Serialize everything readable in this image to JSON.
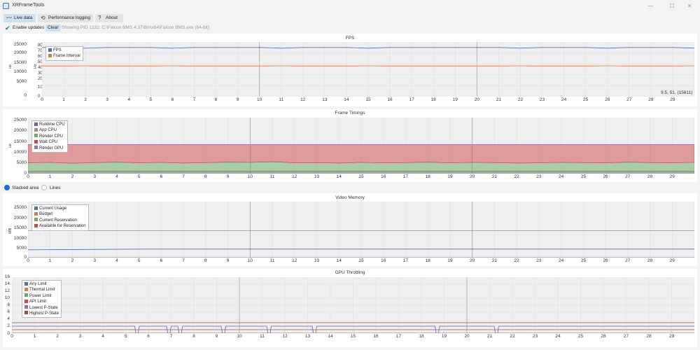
{
  "window": {
    "title": "XRFrameTools",
    "minimize_glyph": "—",
    "maximize_glyph": "☐",
    "close_glyph": "✕"
  },
  "tabs": [
    {
      "label": "Live data",
      "icon": "pulse-icon",
      "glyph": "〰",
      "active": true
    },
    {
      "label": "Performance logging",
      "icon": "history-icon",
      "glyph": "⟲",
      "active": false
    },
    {
      "label": "About",
      "icon": "help-icon",
      "glyph": "?",
      "active": false
    }
  ],
  "toolbar": {
    "enable_updates_label": "Enable updates",
    "enable_updates_checked": true,
    "check_glyph": "✔",
    "clear_label": "Clear",
    "status_text": "Showing PID 1232: C:\\Falcon BMS 4.37\\Bin\\x64\\Falcon BMS.exe (64-bit)"
  },
  "x_axis_ticks": [
    "0",
    "1",
    "2",
    "3",
    "4",
    "5",
    "6",
    "7",
    "8",
    "9",
    "10",
    "11",
    "12",
    "13",
    "14",
    "15",
    "16",
    "17",
    "18",
    "19",
    "20",
    "21",
    "22",
    "23",
    "24",
    "25",
    "26",
    "27",
    "28",
    "29"
  ],
  "fps_chart": {
    "title": "FPS",
    "y_unit": "us",
    "y_unit_right": "Hz",
    "y_ticks_left": [
      "25000",
      "20000",
      "15000",
      "10000",
      "5000",
      "0"
    ],
    "y_ticks_right": [
      "80",
      "70",
      "60",
      "50",
      "40",
      "30",
      "20",
      "10",
      "0"
    ],
    "readout": "9.5, 51, (15811)",
    "legend": [
      {
        "name": "FPS",
        "color": "#4f6fb5"
      },
      {
        "name": "Frame Interval",
        "color": "#e07a45"
      }
    ]
  },
  "frame_timings_chart": {
    "title": "Frame Timings",
    "y_unit": "us",
    "y_ticks": [
      "25000",
      "20000",
      "15000",
      "10000",
      "5000",
      "0"
    ],
    "legend": [
      {
        "name": "Runtime CPU",
        "color": "#4f6fb5"
      },
      {
        "name": "App CPU",
        "color": "#e07a45"
      },
      {
        "name": "Render CPU",
        "color": "#5fae5f"
      },
      {
        "name": "Wait CPU",
        "color": "#d04545"
      },
      {
        "name": "Render GPU",
        "color": "#8e72c0"
      }
    ]
  },
  "display_mode": {
    "stacked_label": "Stacked area",
    "lines_label": "Lines",
    "selected": "stacked"
  },
  "video_memory_chart": {
    "title": "Video Memory",
    "y_unit": "MB",
    "y_ticks": [
      "25000",
      "20000",
      "15000",
      "10000",
      "5000",
      "0"
    ],
    "legend": [
      {
        "name": "Current Usage",
        "color": "#4f6fb5"
      },
      {
        "name": "Budget",
        "color": "#e07a45"
      },
      {
        "name": "Current Reservation",
        "color": "#5fae5f"
      },
      {
        "name": "Available for Reservation",
        "color": "#d04545"
      }
    ]
  },
  "gpu_throttling_chart": {
    "title": "GPU Throttling",
    "y_ticks": [
      "16",
      "14",
      "12",
      "10",
      "8",
      "6",
      "4",
      "2",
      "0"
    ],
    "legend": [
      {
        "name": "Any Limit",
        "color": "#4f6fb5"
      },
      {
        "name": "Thermal Limit",
        "color": "#e07a45"
      },
      {
        "name": "Power Limit",
        "color": "#5fae5f"
      },
      {
        "name": "API Limit",
        "color": "#d04545"
      },
      {
        "name": "Lowest P-State",
        "color": "#8e72c0"
      },
      {
        "name": "Highest P-State",
        "color": "#8b5a3c"
      }
    ]
  },
  "chart_data": [
    {
      "type": "line",
      "title": "FPS",
      "x_range": [
        0,
        30
      ],
      "ylim_left": [
        0,
        25000
      ],
      "ylim_right": [
        0,
        80
      ],
      "xlabel": "",
      "ylabel": "us",
      "grid": true,
      "legend_position": "top-left",
      "series": [
        {
          "name": "FPS",
          "axis": "right",
          "color": "#4f6fb5",
          "x": [
            0,
            1,
            2,
            3,
            4,
            5,
            6,
            7,
            8,
            9,
            10,
            11,
            12,
            13,
            14,
            15,
            16,
            17,
            18,
            19,
            20,
            21,
            22,
            23,
            24,
            25,
            26,
            27,
            28,
            29,
            30
          ],
          "values": [
            72,
            72,
            71,
            72,
            72,
            72,
            71,
            72,
            72,
            72,
            72,
            71,
            72,
            72,
            72,
            71,
            72,
            72,
            72,
            72,
            72,
            72,
            71,
            72,
            72,
            72,
            71,
            72,
            72,
            72,
            71
          ]
        },
        {
          "name": "Frame Interval",
          "axis": "left",
          "color": "#e07a45",
          "x": [
            0,
            1,
            2,
            3,
            4,
            5,
            6,
            7,
            8,
            9,
            10,
            11,
            12,
            13,
            14,
            15,
            16,
            17,
            18,
            19,
            20,
            21,
            22,
            23,
            24,
            25,
            26,
            27,
            28,
            29,
            30
          ],
          "values": [
            14000,
            14000,
            14100,
            14000,
            14000,
            14000,
            14100,
            14000,
            14000,
            14000,
            14000,
            14100,
            14000,
            14000,
            14000,
            14100,
            14000,
            14000,
            14000,
            14000,
            14000,
            14000,
            14100,
            14000,
            14000,
            14000,
            14100,
            14000,
            14000,
            14000,
            14100
          ]
        }
      ]
    },
    {
      "type": "area",
      "title": "Frame Timings",
      "stacked": true,
      "x_range": [
        0,
        30
      ],
      "ylim": [
        0,
        27000
      ],
      "xlabel": "",
      "ylabel": "us",
      "grid": true,
      "legend_position": "top-left",
      "x": [
        0,
        1,
        2,
        3,
        4,
        5,
        6,
        7,
        8,
        9,
        10,
        11,
        12,
        13,
        14,
        15,
        16,
        17,
        18,
        19,
        20,
        21,
        22,
        23,
        24,
        25,
        26,
        27,
        28,
        29,
        30
      ],
      "series": [
        {
          "name": "Runtime CPU",
          "color": "#4f6fb5",
          "values": [
            1000,
            1000,
            1000,
            1000,
            1000,
            1000,
            1000,
            1000,
            1000,
            1000,
            1000,
            1000,
            1000,
            1000,
            1000,
            1000,
            1000,
            1000,
            1000,
            1000,
            1000,
            1000,
            1000,
            1000,
            1000,
            1000,
            1000,
            1000,
            1000,
            1000,
            1000
          ]
        },
        {
          "name": "App CPU",
          "color": "#e07a45",
          "values": [
            200,
            200,
            200,
            200,
            200,
            200,
            200,
            200,
            200,
            200,
            200,
            200,
            200,
            200,
            200,
            200,
            200,
            200,
            200,
            200,
            200,
            200,
            200,
            200,
            200,
            200,
            200,
            200,
            200,
            200,
            200
          ]
        },
        {
          "name": "Render CPU",
          "color": "#5fae5f",
          "values": [
            4000,
            4200,
            3800,
            4100,
            4300,
            4000,
            4200,
            3900,
            4100,
            4300,
            4200,
            4500,
            4000,
            4100,
            3900,
            4200,
            4000,
            4100,
            4300,
            4000,
            4200,
            4100,
            3900,
            4000,
            4200,
            4100,
            4000,
            4300,
            4100,
            4000,
            4200
          ]
        },
        {
          "name": "Wait CPU",
          "color": "#d04545",
          "values": [
            8800,
            8600,
            9000,
            8700,
            8500,
            8800,
            8600,
            8900,
            8700,
            8500,
            8600,
            8300,
            8800,
            8700,
            8900,
            8600,
            8800,
            8700,
            8500,
            8800,
            8600,
            8700,
            8900,
            8800,
            8600,
            8700,
            8800,
            8500,
            8700,
            8800,
            8600
          ]
        },
        {
          "name": "Render GPU",
          "color": "#8e72c0",
          "values": [
            0,
            0,
            0,
            0,
            0,
            0,
            0,
            0,
            0,
            0,
            0,
            0,
            0,
            0,
            0,
            0,
            0,
            0,
            0,
            0,
            0,
            0,
            0,
            0,
            0,
            0,
            0,
            0,
            0,
            0,
            0
          ]
        }
      ]
    },
    {
      "type": "line",
      "title": "Video Memory",
      "x_range": [
        0,
        30
      ],
      "ylim": [
        0,
        25000
      ],
      "xlabel": "",
      "ylabel": "MB",
      "grid": true,
      "legend_position": "top-left",
      "x": [
        0,
        5.5,
        30
      ],
      "series": [
        {
          "name": "Current Usage",
          "color": "#4f6fb5",
          "values": [
            3500,
            3800,
            3800
          ]
        },
        {
          "name": "Budget",
          "color": "#e07a45",
          "values": [
            12000,
            12000,
            12000
          ]
        },
        {
          "name": "Current Reservation",
          "color": "#5fae5f",
          "values": [
            0,
            0,
            0
          ]
        },
        {
          "name": "Available for Reservation",
          "color": "#d04545",
          "values": [
            0,
            0,
            0
          ]
        }
      ]
    },
    {
      "type": "line",
      "title": "GPU Throttling",
      "x_range": [
        0,
        30
      ],
      "ylim": [
        0,
        16
      ],
      "xlabel": "",
      "ylabel": "",
      "grid": true,
      "legend_position": "top-left",
      "series": [
        {
          "name": "Any Limit",
          "color": "#4f6fb5",
          "x": [
            0,
            5.4,
            5.45,
            5.55,
            5.6,
            6.8,
            6.85,
            6.95,
            7.0,
            7.3,
            7.35,
            7.45,
            7.5,
            9.2,
            9.25,
            9.35,
            9.4,
            11.2,
            11.25,
            11.35,
            11.4,
            13.2,
            13.25,
            13.35,
            13.4,
            18.6,
            18.65,
            18.75,
            18.8,
            21.2,
            21.25,
            21.35,
            21.4,
            30
          ],
          "values": [
            2,
            2,
            0,
            0,
            2,
            2,
            0,
            0,
            2,
            2,
            0,
            0,
            2,
            2,
            0,
            0,
            2,
            2,
            0,
            0,
            2,
            2,
            0,
            0,
            2,
            2,
            0,
            0,
            2,
            2,
            0,
            0,
            2,
            2
          ]
        },
        {
          "name": "Thermal Limit",
          "color": "#e07a45",
          "x": [
            0,
            30
          ],
          "values": [
            0,
            0
          ]
        },
        {
          "name": "Power Limit",
          "color": "#5fae5f",
          "x": [
            0,
            30
          ],
          "values": [
            0,
            0
          ]
        },
        {
          "name": "API Limit",
          "color": "#d04545",
          "x": [
            0,
            30
          ],
          "values": [
            1,
            1
          ]
        },
        {
          "name": "Lowest P-State",
          "color": "#8e72c0",
          "x": [
            0,
            30
          ],
          "values": [
            0,
            0
          ]
        },
        {
          "name": "Highest P-State",
          "color": "#8b5a3c",
          "x": [
            0,
            30
          ],
          "values": [
            3,
            3
          ]
        }
      ]
    }
  ]
}
